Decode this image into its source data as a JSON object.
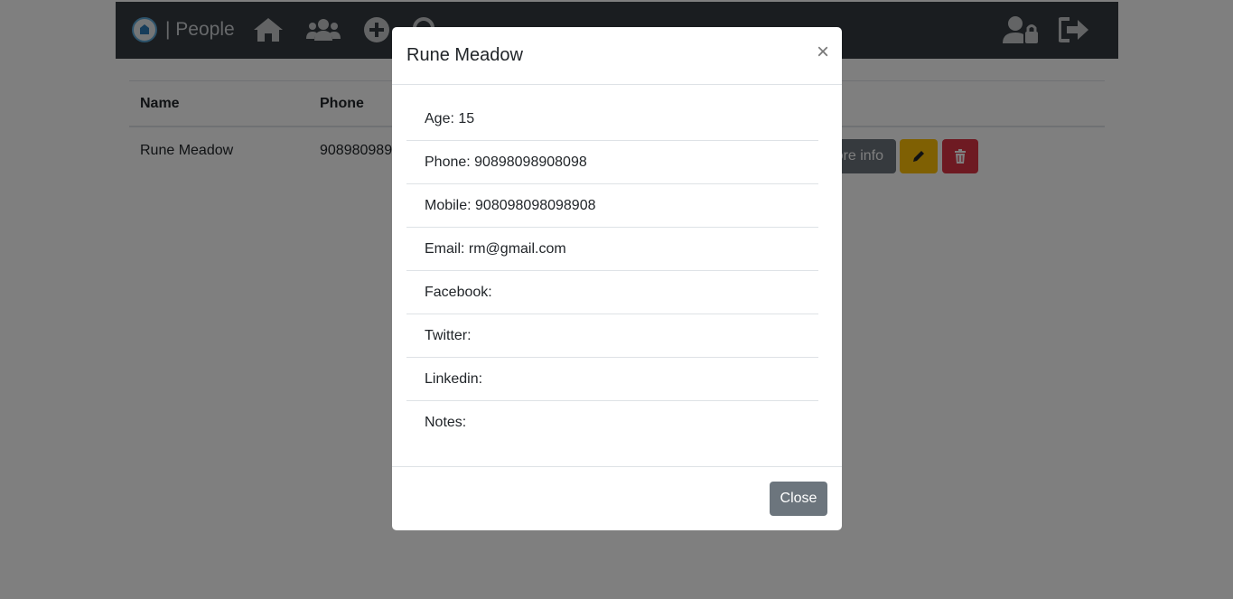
{
  "navbar": {
    "brand_text": "| People",
    "icons": [
      "home-icon",
      "users-icon",
      "add-circle-icon",
      "search-icon",
      "user-lock-icon",
      "logout-icon"
    ]
  },
  "table": {
    "headers": [
      "Name",
      "Phone"
    ],
    "rows": [
      {
        "name": "Rune Meadow",
        "phone": "90898098908098",
        "more_info_label": "More info"
      }
    ]
  },
  "modal": {
    "title": "Rune Meadow",
    "close_glyph": "×",
    "items": [
      "Age: 15",
      "Phone: 90898098908098",
      "Mobile: 908098098098908",
      "Email: rm@gmail.com",
      "Facebook:",
      "Twitter:",
      "Linkedin:",
      "Notes:"
    ],
    "close_button": "Close"
  },
  "colors": {
    "navbar": "#343a40",
    "secondary": "#6c757d",
    "warning": "#ffc107",
    "danger": "#dc3545"
  }
}
